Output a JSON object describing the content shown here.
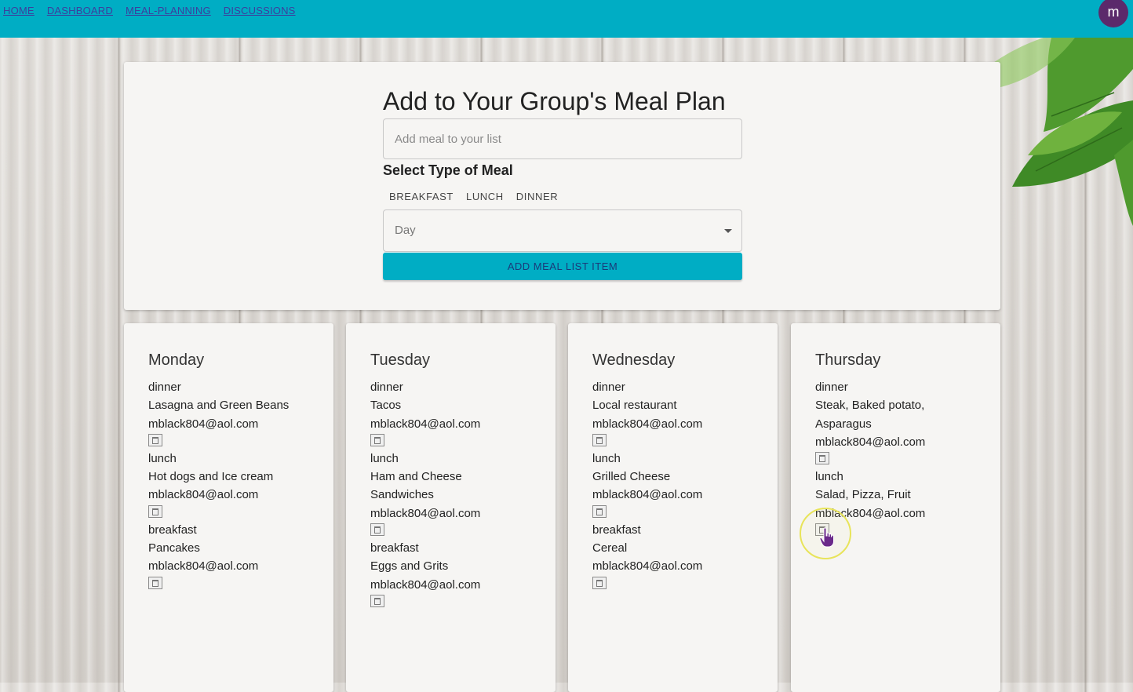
{
  "nav": {
    "links": [
      "HOME",
      "DASHBOARD",
      "MEAL-PLANNING",
      "DISCUSSIONS"
    ]
  },
  "user": {
    "avatar_letter": "m"
  },
  "colors": {
    "accent": "#00adc4",
    "avatar": "#5b2a6b",
    "nav_link": "#3b3f9e"
  },
  "form": {
    "title": "Add to Your Group's Meal Plan",
    "meal_placeholder": "Add meal to your list",
    "select_label": "Select Type of Meal",
    "meal_types": [
      "BREAKFAST",
      "LUNCH",
      "DINNER"
    ],
    "day_placeholder": "Day",
    "add_button": "ADD MEAL LIST ITEM"
  },
  "days": [
    {
      "name": "Monday",
      "meals": [
        {
          "type": "dinner",
          "lines": [
            "Lasagna and Green Beans"
          ],
          "email": "mblack804@aol.com"
        },
        {
          "type": "lunch",
          "lines": [
            "Hot dogs and Ice cream"
          ],
          "email": "mblack804@aol.com"
        },
        {
          "type": "breakfast",
          "lines": [
            "Pancakes"
          ],
          "email": "mblack804@aol.com"
        }
      ]
    },
    {
      "name": "Tuesday",
      "meals": [
        {
          "type": "dinner",
          "lines": [
            "Tacos"
          ],
          "email": "mblack804@aol.com"
        },
        {
          "type": "lunch",
          "lines": [
            "Ham and Cheese",
            "Sandwiches"
          ],
          "email": "mblack804@aol.com"
        },
        {
          "type": "breakfast",
          "lines": [
            "Eggs and Grits"
          ],
          "email": "mblack804@aol.com"
        }
      ]
    },
    {
      "name": "Wednesday",
      "meals": [
        {
          "type": "dinner",
          "lines": [
            "Local restaurant"
          ],
          "email": "mblack804@aol.com"
        },
        {
          "type": "lunch",
          "lines": [
            "Grilled Cheese"
          ],
          "email": "mblack804@aol.com"
        },
        {
          "type": "breakfast",
          "lines": [
            "Cereal"
          ],
          "email": "mblack804@aol.com"
        }
      ]
    },
    {
      "name": "Thursday",
      "meals": [
        {
          "type": "dinner",
          "lines": [
            "Steak, Baked potato,",
            "Asparagus"
          ],
          "email": "mblack804@aol.com"
        },
        {
          "type": "lunch",
          "lines": [
            "Salad, Pizza, Fruit"
          ],
          "email": "mblack804@aol.com"
        }
      ]
    }
  ],
  "icons": {
    "delete": "trash-icon",
    "pointer": "hand-pointer-icon"
  }
}
